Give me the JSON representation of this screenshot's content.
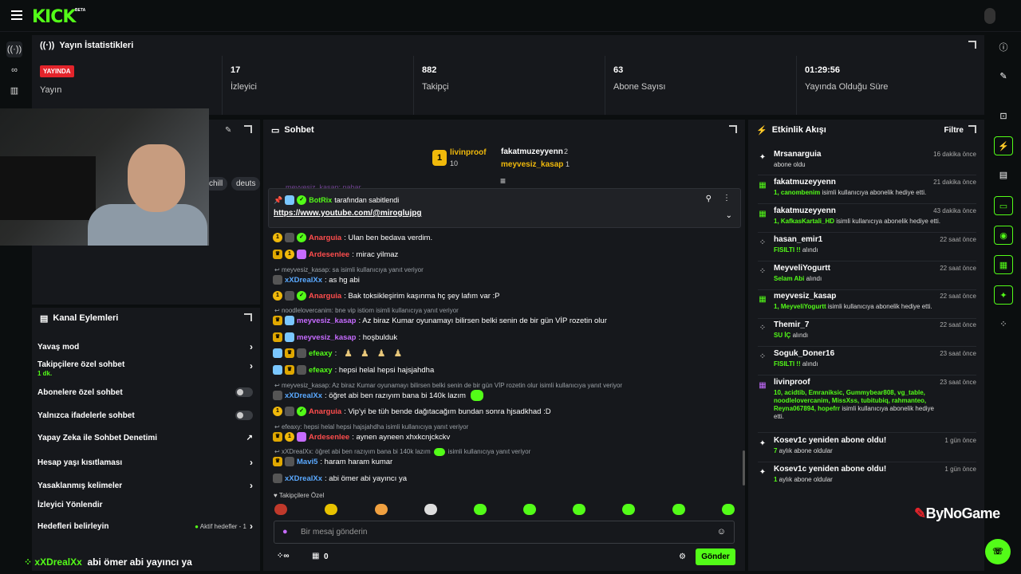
{
  "topbar": {
    "logo": "KICK",
    "beta": "BETA"
  },
  "stats": {
    "title": "Yayın İstatistikleri",
    "live_badge": "YAYINDA",
    "live_label": "Yayın",
    "viewers_value": "17",
    "viewers_label": "İzleyici",
    "followers_value": "882",
    "followers_label": "Takipçi",
    "subs_value": "63",
    "subs_label": "Abone Sayısı",
    "uptime_value": "01:29:56",
    "uptime_label": "Yayında Olduğu Süre"
  },
  "video": {
    "tags": [
      "chill",
      "deuts"
    ]
  },
  "actions": {
    "title": "Kanal Eylemleri",
    "items": [
      {
        "label": "Yavaş mod"
      },
      {
        "label": "Takipçilere özel sohbet",
        "sub": "1 dk."
      },
      {
        "label": "Abonelere özel sohbet"
      },
      {
        "label": "Yalnızca ifadelerle sohbet"
      },
      {
        "label": "Yapay Zeka ile Sohbet Denetimi"
      },
      {
        "label": "Hesap yaşı kısıtlaması"
      },
      {
        "label": "Yasaklanmış kelimeler"
      },
      {
        "label": "İzleyici Yönlendir"
      },
      {
        "label": "Hedefleri belirleyin",
        "sub": "Aktif hedefler - 1"
      }
    ]
  },
  "chat": {
    "title": "Sohbet",
    "top_gifter": {
      "name": "livinproof",
      "count": "10"
    },
    "gifters": [
      {
        "name": "fakatmuzeyyenn",
        "count": "2"
      },
      {
        "name": "meyvesiz_kasap",
        "count": "1"
      }
    ],
    "partial_top": "meyvesiz_kasap: nabar",
    "pinned": {
      "by": "BotRix",
      "suffix": "tarafından sabitlendi",
      "link": "https://www.youtube.com/@miroglujpg"
    },
    "messages": [
      {
        "user": "Anarguia",
        "text": ": Ulan ben bedava verdim.",
        "color": "#ff4d4d"
      },
      {
        "user": "Ardesenlee",
        "text": ": mirac yilmaz",
        "color": "#ff4d4d"
      },
      {
        "reply": "meyvesiz_kasap: sa isimli kullanıcıya yanıt veriyor"
      },
      {
        "user": "xXDrealXx",
        "text": ": as hg abi",
        "color": "#5aa9ff"
      },
      {
        "user": "Anarguia",
        "text": ": Bak toksikleşirim kaşınma hç şey lafım var :P",
        "color": "#ff4d4d"
      },
      {
        "reply": "noodlelovercanim: bne vip istiom isimli kullanıcıya yanıt veriyor"
      },
      {
        "user": "meyvesiz_kasap",
        "text": ": Az biraz Kumar oyunamayı bilirsen belki senin de bir gün VİP rozetin olur",
        "color": "#c66bff"
      },
      {
        "user": "meyvesiz_kasap",
        "text": ": hoşbulduk",
        "color": "#c66bff"
      },
      {
        "user": "efeaxy",
        "text": ":",
        "color": "#53fc18"
      },
      {
        "user": "efeaxy",
        "text": ": hepsi helal hepsi hajsjahdha",
        "color": "#53fc18"
      },
      {
        "reply": "meyvesiz_kasap: Az biraz Kumar oyunamayı bilirsen belki senin de bir gün VİP rozetin olur isimli kullanıcıya yanıt veriyor"
      },
      {
        "user": "xXDrealXx",
        "text": ": öğret abi ben razıyım bana bi 140k lazım",
        "color": "#5aa9ff"
      },
      {
        "user": "Anarguia",
        "text": ": Vip'yi be tüh bende dağıtacağım bundan sonra hjsadkhad :D",
        "color": "#ff4d4d"
      },
      {
        "reply": "efeaxy: hepsi helal hepsi hajsjahdha isimli kullanıcıya yanıt veriyor"
      },
      {
        "user": "Ardesenlee",
        "text": ": aynen ayneen xhxkcnjckckv",
        "color": "#ff4d4d"
      },
      {
        "reply": "xXDrealXx: öğret abi ben razıyım bana bi 140k lazım"
      },
      {
        "reply2": "isimli kullanıcıya yanıt veriyor"
      },
      {
        "user": "Mavi5",
        "text": ": haram haram kumar",
        "color": "#5aa9ff"
      },
      {
        "user": "xXDrealXx",
        "text": ": abi ömer abi yayıncı ya",
        "color": "#5aa9ff"
      }
    ],
    "followers_only": "Takipçilere Özel",
    "input_placeholder": "Bir mesaj gönderin",
    "bottom_count": "0",
    "send": "Gönder"
  },
  "activity": {
    "title": "Etkinlik Akışı",
    "filter": "Filtre",
    "events": [
      {
        "name": "Mrsanarguia",
        "time": "16 dakika önce",
        "desc": "abone oldu"
      },
      {
        "name": "fakatmuzeyyenn",
        "time": "21 dakika önce",
        "hl": "1, canombenim",
        "desc": " isimli kullanıcıya abonelik hediye etti."
      },
      {
        "name": "fakatmuzeyyenn",
        "time": "43 dakika önce",
        "hl": "1, KafkasKartali_HD",
        "desc": " isimli kullanıcıya abonelik hediye etti."
      },
      {
        "name": "hasan_emir1",
        "time": "22 saat önce",
        "hl": "FISILTI !!",
        "desc": " alındı"
      },
      {
        "name": "MeyveliYogurtt",
        "time": "22 saat önce",
        "hl": "Selam Abi",
        "desc": " alındı"
      },
      {
        "name": "meyvesiz_kasap",
        "time": "22 saat önce",
        "hl": "1, MeyveliYogurtt",
        "desc": " isimli kullanıcıya abonelik hediye etti."
      },
      {
        "name": "Themir_7",
        "time": "22 saat önce",
        "hl": "SU İÇ",
        "desc": " alındı"
      },
      {
        "name": "Soguk_Doner16",
        "time": "23 saat önce",
        "hl": "FISILTI !!",
        "desc": " alındı"
      },
      {
        "name": "livinproof",
        "time": "23 saat önce",
        "hl": "10, acidtib, Emraniksic, Gummybear808, vg_table, noodlelovercanim, MissXss, tubitubiq, rahmanteo, Reyna067894, hopefrr",
        "desc": " isimli kullanıcıya abonelik hediye etti."
      },
      {
        "name": "Kosev1c yeniden abone oldu!",
        "time": "1 gün önce",
        "hl": "7",
        "desc": " aylık abone oldular"
      },
      {
        "name": "Kosev1c yeniden abone oldu!",
        "time": "1 gün önce",
        "hl": "1",
        "desc": " aylık abone oldular"
      }
    ]
  },
  "overlay": {
    "user": "xXDrealXx",
    "text": "abi ömer abi yayıncı ya"
  },
  "brand": "ByNoGame",
  "colors": {
    "accent": "#53fc18",
    "live": "#e3242b",
    "panel": "#16181c"
  }
}
